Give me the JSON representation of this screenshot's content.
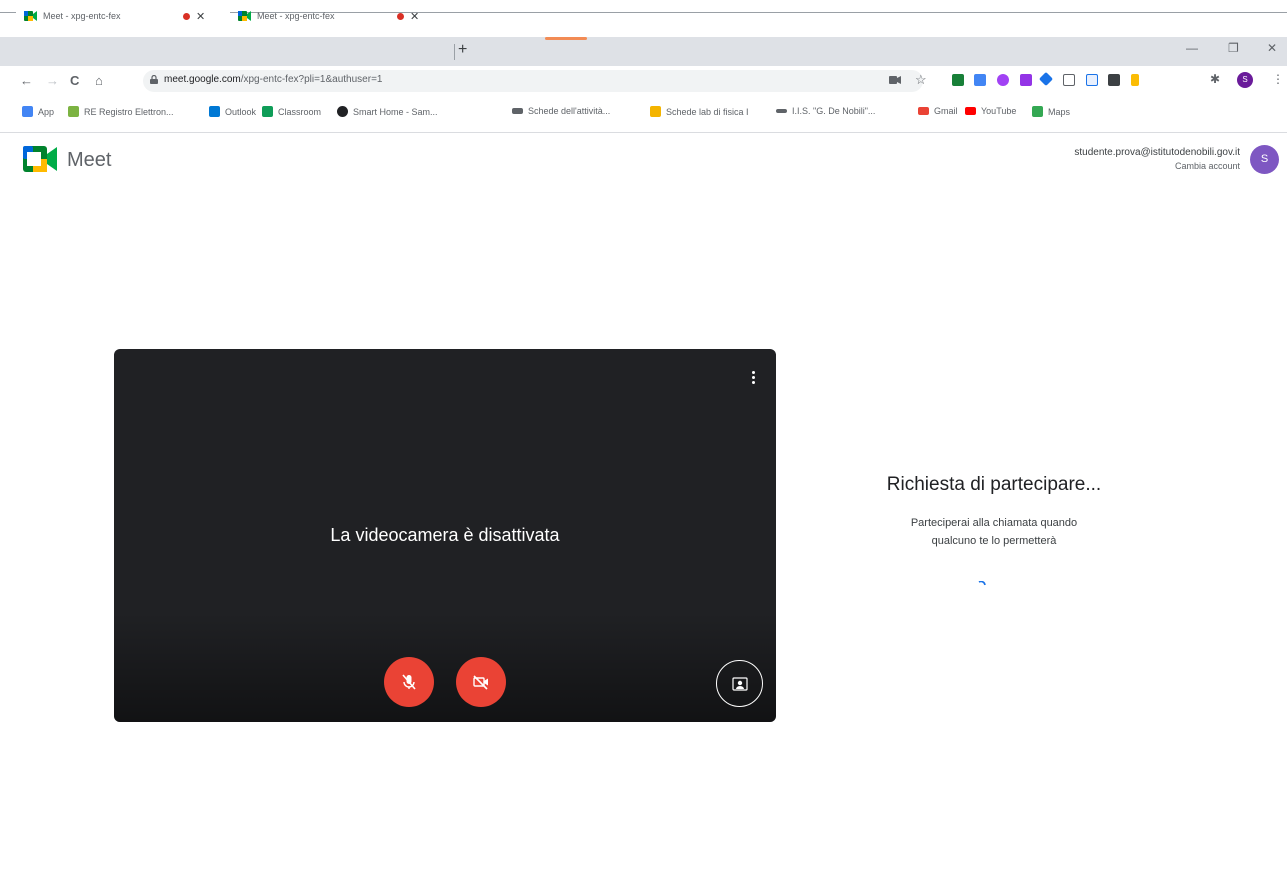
{
  "browser": {
    "tabs": [
      {
        "title": "Meet - xpg-entc-fex"
      },
      {
        "title": "Meet - xpg-entc-fex"
      }
    ],
    "new_tab": "+",
    "window_controls": {
      "minimize": "—",
      "restore": "❐",
      "close": "✕"
    },
    "nav": {
      "back": "←",
      "forward": "→",
      "reload": "C",
      "home": "⌂"
    },
    "url": {
      "host": "meet.google.com",
      "path": "/xpg-entc-fex?pli=1&authuser=1"
    },
    "profile_initial": "S",
    "bookmarks": [
      {
        "label": "App",
        "color": "#4285f4"
      },
      {
        "label": "RE Registro Elettron...",
        "color": "#7cb342"
      },
      {
        "label": "Outlook",
        "color": "#0078d4"
      },
      {
        "label": "Classroom",
        "color": "#0f9d58"
      },
      {
        "label": "Smart Home - Sam...",
        "color": "#202124"
      },
      {
        "label": "Schede dell'attività...",
        "color": "#5f6368"
      },
      {
        "label": "Schede lab di fisica I",
        "color": "#f4b400"
      },
      {
        "label": "I.I.S. \"G. De Nobili\"...",
        "color": "#5f6368"
      },
      {
        "label": "Gmail",
        "color": "#ea4335"
      },
      {
        "label": "YouTube",
        "color": "#ff0000"
      },
      {
        "label": "Maps",
        "color": "#34a853"
      }
    ]
  },
  "meet": {
    "brand": "Meet",
    "account": {
      "email": "studente.prova@istitutodenobili.gov.it",
      "switch_label": "Cambia account",
      "initial": "S"
    },
    "preview": {
      "camera_off_text": "La videocamera è disattivata",
      "mic_state": "off",
      "camera_state": "off"
    },
    "waiting": {
      "title": "Richiesta di partecipare...",
      "message_line1": "Parteciperai alla chiamata quando",
      "message_line2": "qualcuno te lo permetterà"
    }
  },
  "colors": {
    "accent_red": "#ea4335",
    "preview_bg": "#202124",
    "avatar": "#7e57c2"
  }
}
